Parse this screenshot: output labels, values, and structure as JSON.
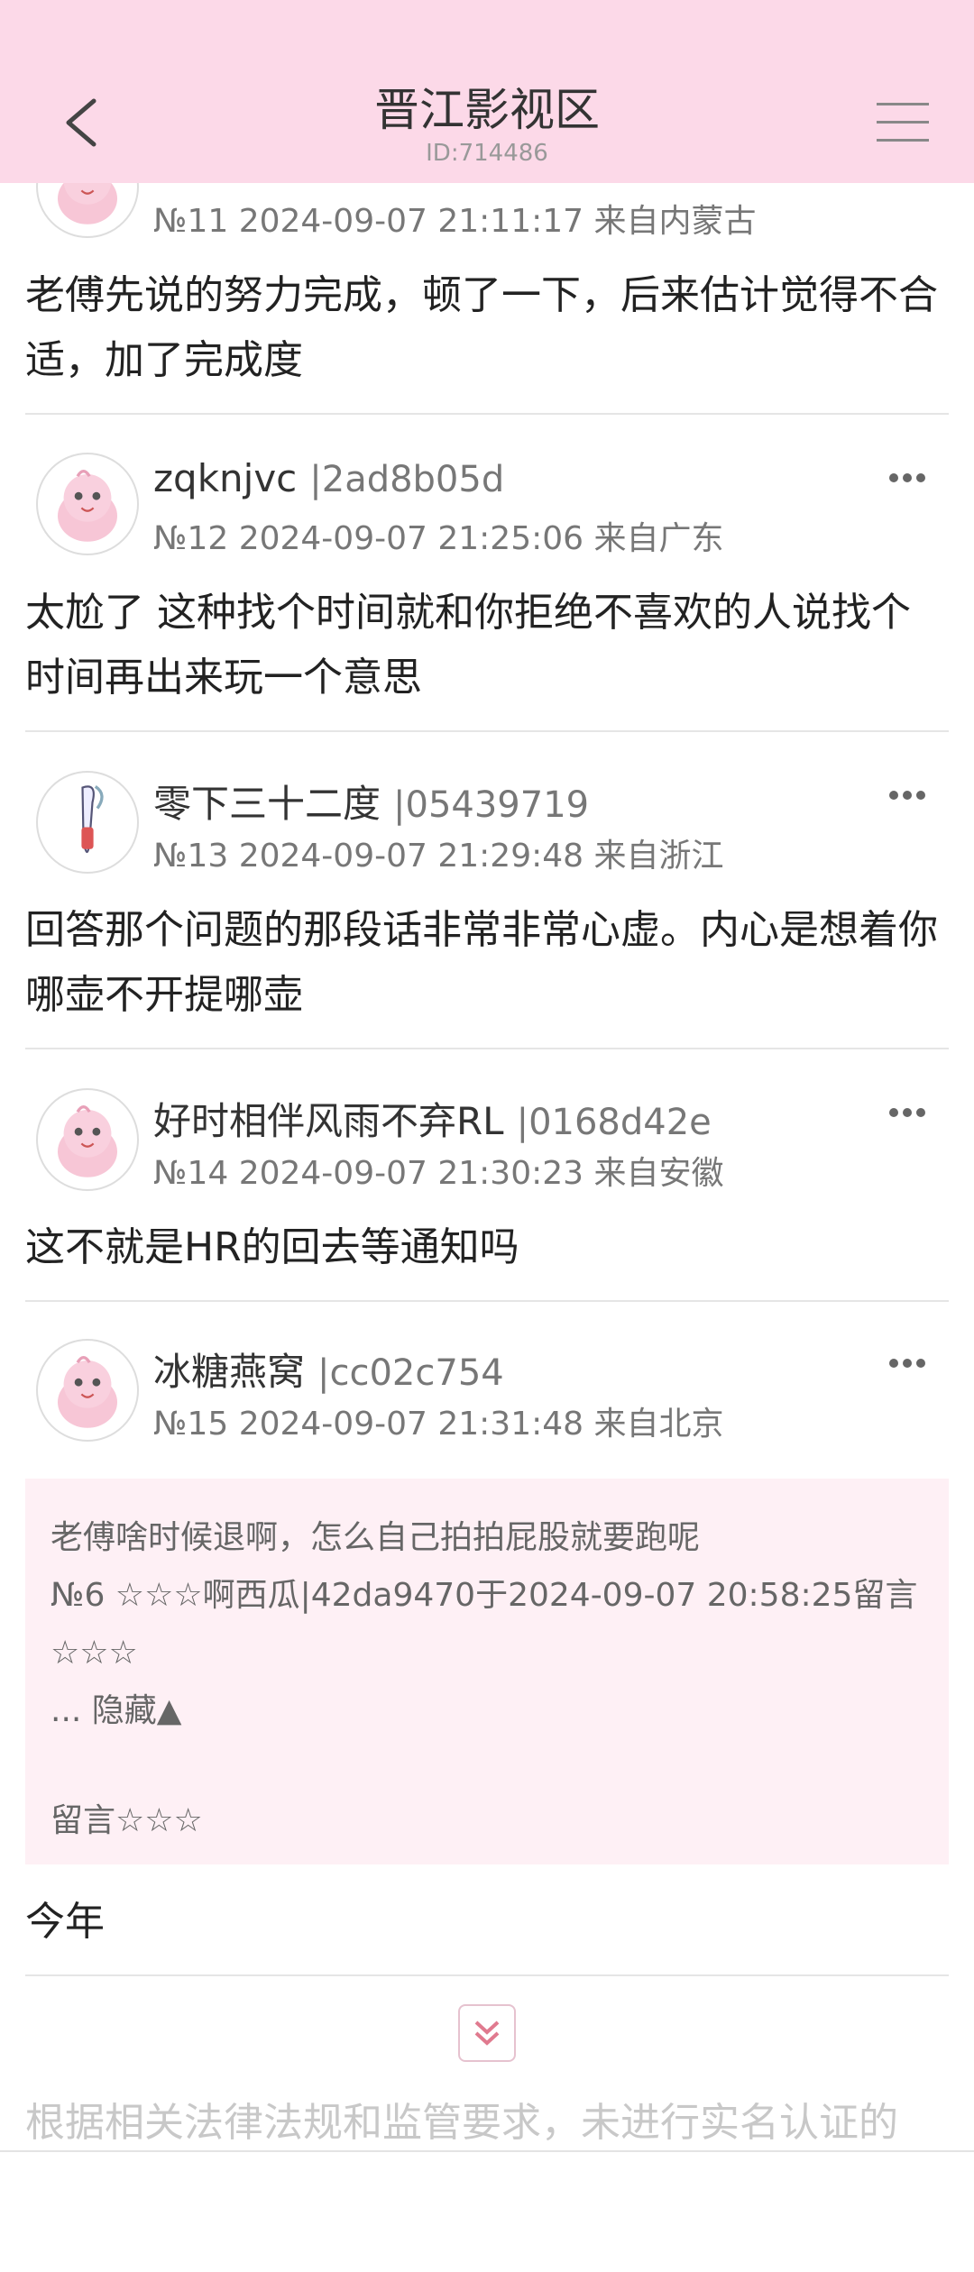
{
  "header": {
    "title": "晋江影视区",
    "subtitle": "ID:714486",
    "back_icon": "chevron-left-icon",
    "menu_icon": "hamburger-menu-icon"
  },
  "posts": [
    {
      "name": "",
      "uid": "",
      "meta": "№11 2024-09-07 21:11:17 来自内蒙古",
      "body": "老傅先说的努力完成，顿了一下，后来估计觉得不合适，加了完成度"
    },
    {
      "name": "zqknjvc",
      "uid": "|2ad8b05d",
      "meta": "№12 2024-09-07 21:25:06 来自广东",
      "body": "太尬了 这种找个时间就和你拒绝不喜欢的人说找个时间再出来玩一个意思"
    },
    {
      "name": "零下三十二度",
      "uid": "|05439719",
      "meta": "№13 2024-09-07 21:29:48 来自浙江",
      "body": "回答那个问题的那段话非常非常心虚。内心是想着你哪壶不开提哪壶"
    },
    {
      "name": "好时相伴风雨不弃RL",
      "uid": "|0168d42e",
      "meta": "№14 2024-09-07 21:30:23 来自安徽",
      "body": "这不就是HR的回去等通知吗"
    },
    {
      "name": "冰糖燕窝",
      "uid": "|cc02c754",
      "meta": "№15 2024-09-07 21:31:48 来自北京",
      "quote": {
        "text": "老傅啥时候退啊，怎么自己拍拍屁股就要跑呢",
        "ref_line1": "№6 ☆☆☆啊西瓜|42da9470于2024-09-07 20:58:25留言",
        "ref_line2": "☆☆☆",
        "hide": "... 隐藏▲",
        "reply": "留言☆☆☆"
      },
      "body": "今年"
    }
  ],
  "expand_icon": "double-chevron-down-icon",
  "notice": "根据相关法律法规和监管要求，未进行实名认证的",
  "colors": {
    "header_bg": "#fcd9e8",
    "quote_bg": "#fef0f5",
    "accent": "#e07a8f"
  }
}
